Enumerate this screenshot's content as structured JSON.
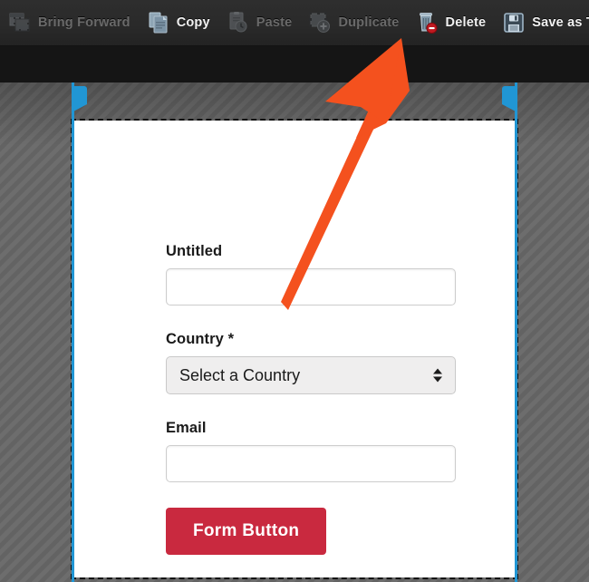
{
  "toolbar": {
    "items": [
      {
        "label": "Bring Forward",
        "icon": "bring-forward-icon",
        "enabled": false
      },
      {
        "label": "Copy",
        "icon": "copy-icon",
        "enabled": true
      },
      {
        "label": "Paste",
        "icon": "paste-icon",
        "enabled": false
      },
      {
        "label": "Duplicate",
        "icon": "duplicate-icon",
        "enabled": false
      },
      {
        "label": "Delete",
        "icon": "delete-trash-icon",
        "enabled": true
      },
      {
        "label": "Save as Template",
        "icon": "save-floppy-icon",
        "enabled": true
      }
    ]
  },
  "annotation": {
    "arrow_color": "#f4511e",
    "points_to": "Delete"
  },
  "canvas": {
    "selection_border_color": "#111111",
    "guide_color": "#2196d4",
    "background": "diagonal-stripes-gray"
  },
  "form": {
    "fields": [
      {
        "label": "Untitled",
        "type": "text",
        "value": "",
        "placeholder": ""
      },
      {
        "label": "Country *",
        "type": "select",
        "value": "Select a Country"
      },
      {
        "label": "Email",
        "type": "text",
        "value": "",
        "placeholder": ""
      }
    ],
    "submit_button": {
      "label": "Form Button",
      "color": "#c9293f"
    }
  }
}
